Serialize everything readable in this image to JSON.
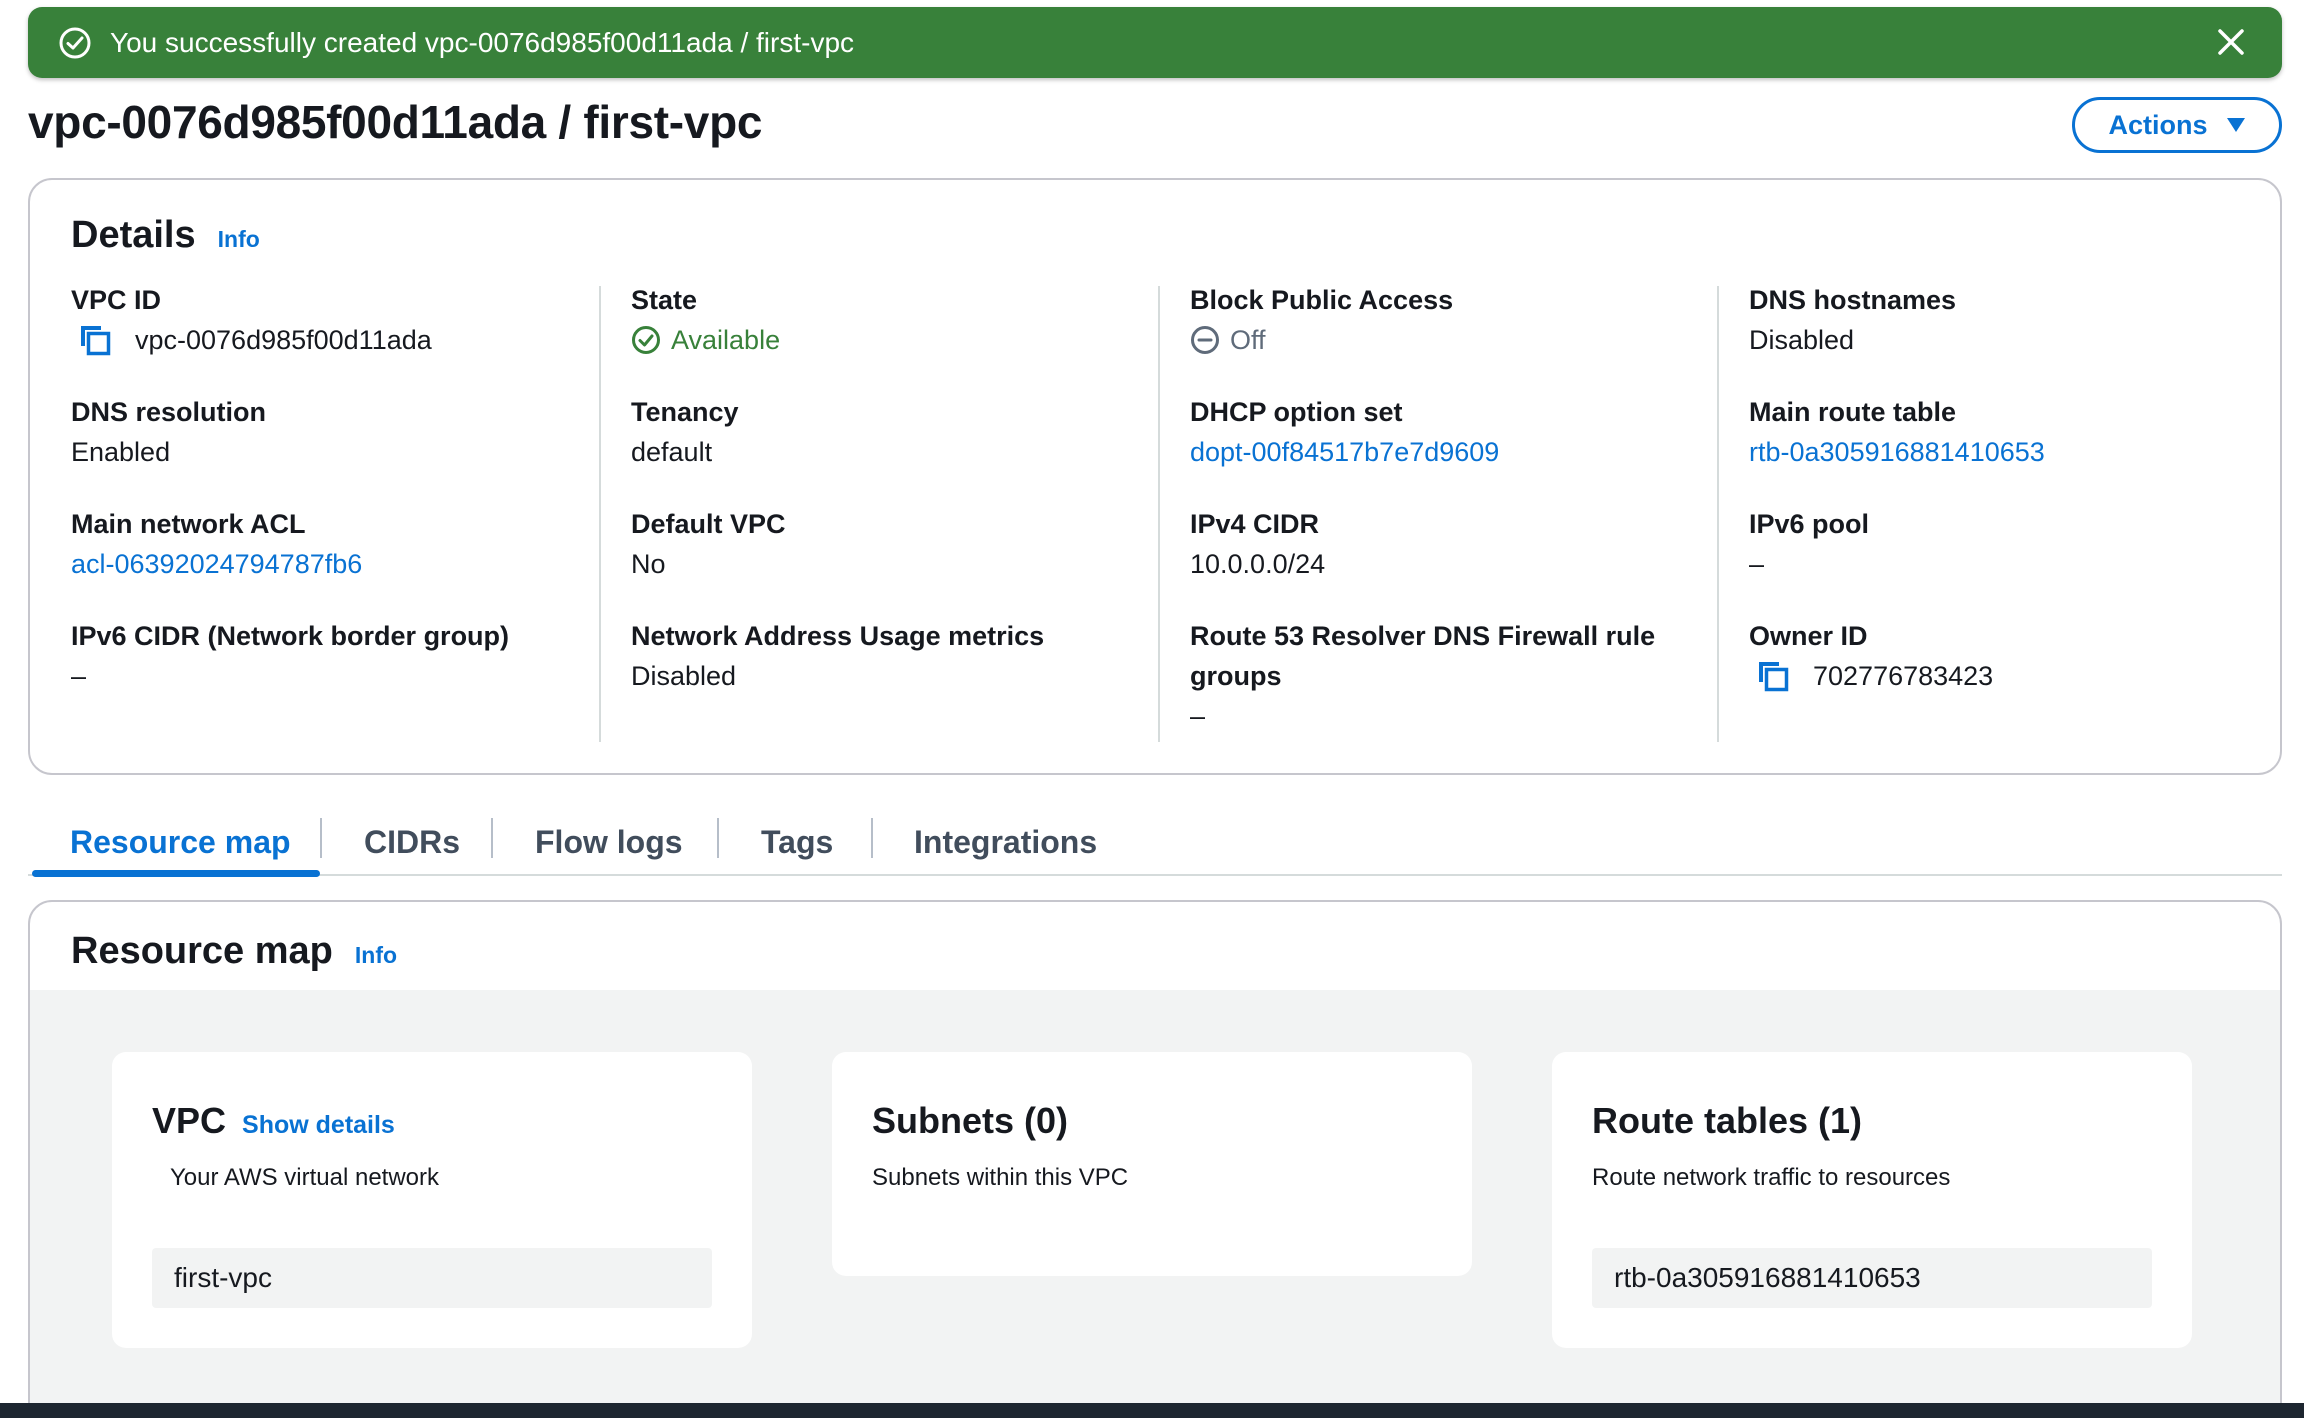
{
  "flash": {
    "message": "You successfully created vpc-0076d985f00d11ada / first-vpc",
    "color": "#38813a"
  },
  "header": {
    "title": "vpc-0076d985f00d11ada / first-vpc",
    "actions_label": "Actions"
  },
  "details": {
    "title": "Details",
    "info": "Info",
    "fields": {
      "vpc_id": {
        "label": "VPC ID",
        "value": "vpc-0076d985f00d11ada"
      },
      "dns_resolution": {
        "label": "DNS resolution",
        "value": "Enabled"
      },
      "main_network_acl": {
        "label": "Main network ACL",
        "value": "acl-06392024794787fb6"
      },
      "ipv6_cidr": {
        "label": "IPv6 CIDR (Network border group)",
        "value": "–"
      },
      "state": {
        "label": "State",
        "value": "Available"
      },
      "tenancy": {
        "label": "Tenancy",
        "value": "default"
      },
      "default_vpc": {
        "label": "Default VPC",
        "value": "No"
      },
      "nau_metrics": {
        "label": "Network Address Usage metrics",
        "value": "Disabled"
      },
      "block_public_access": {
        "label": "Block Public Access",
        "value": "Off"
      },
      "dhcp_option_set": {
        "label": "DHCP option set",
        "value": "dopt-00f84517b7e7d9609"
      },
      "ipv4_cidr": {
        "label": "IPv4 CIDR",
        "value": "10.0.0.0/24"
      },
      "route53_firewall": {
        "label_line1": "Route 53 Resolver DNS Firewall rule",
        "label_line2": "groups",
        "value": "–"
      },
      "dns_hostnames": {
        "label": "DNS hostnames",
        "value": "Disabled"
      },
      "main_route_table": {
        "label": "Main route table",
        "value": "rtb-0a305916881410653"
      },
      "ipv6_pool": {
        "label": "IPv6 pool",
        "value": "–"
      },
      "owner_id": {
        "label": "Owner ID",
        "value": "702776783423"
      }
    }
  },
  "tabs": [
    {
      "label": "Resource map",
      "active": true
    },
    {
      "label": "CIDRs",
      "active": false
    },
    {
      "label": "Flow logs",
      "active": false
    },
    {
      "label": "Tags",
      "active": false
    },
    {
      "label": "Integrations",
      "active": false
    }
  ],
  "resource_map": {
    "title": "Resource map",
    "info": "Info",
    "cards": {
      "vpc": {
        "title": "VPC",
        "link": "Show details",
        "subtitle": "Your AWS virtual network",
        "item": "first-vpc"
      },
      "subnets": {
        "title": "Subnets (0)",
        "subtitle": "Subnets within this VPC"
      },
      "route_tables": {
        "title": "Route tables (1)",
        "subtitle": "Route network traffic to resources",
        "item": "rtb-0a305916881410653"
      }
    }
  },
  "colors": {
    "link": "#0972d3",
    "success": "#38813a",
    "text": "#16191f"
  }
}
